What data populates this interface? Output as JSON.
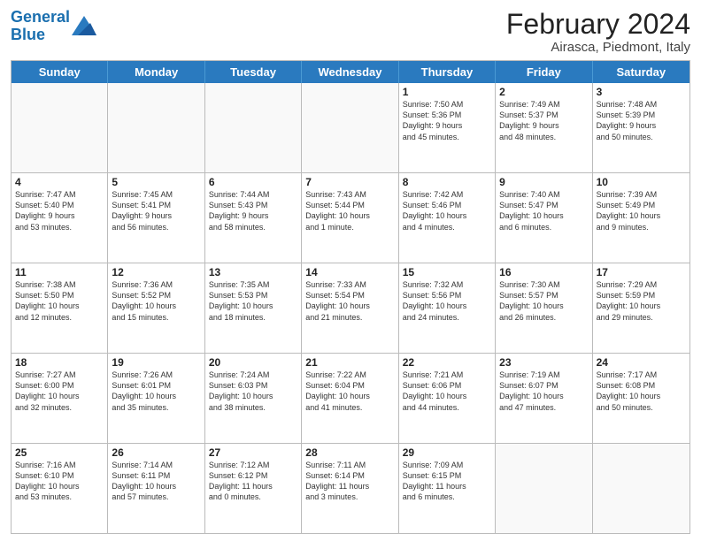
{
  "logo": {
    "line1": "General",
    "line2": "Blue"
  },
  "title": "February 2024",
  "subtitle": "Airasca, Piedmont, Italy",
  "headers": [
    "Sunday",
    "Monday",
    "Tuesday",
    "Wednesday",
    "Thursday",
    "Friday",
    "Saturday"
  ],
  "rows": [
    [
      {
        "day": "",
        "info": ""
      },
      {
        "day": "",
        "info": ""
      },
      {
        "day": "",
        "info": ""
      },
      {
        "day": "",
        "info": ""
      },
      {
        "day": "1",
        "info": "Sunrise: 7:50 AM\nSunset: 5:36 PM\nDaylight: 9 hours\nand 45 minutes."
      },
      {
        "day": "2",
        "info": "Sunrise: 7:49 AM\nSunset: 5:37 PM\nDaylight: 9 hours\nand 48 minutes."
      },
      {
        "day": "3",
        "info": "Sunrise: 7:48 AM\nSunset: 5:39 PM\nDaylight: 9 hours\nand 50 minutes."
      }
    ],
    [
      {
        "day": "4",
        "info": "Sunrise: 7:47 AM\nSunset: 5:40 PM\nDaylight: 9 hours\nand 53 minutes."
      },
      {
        "day": "5",
        "info": "Sunrise: 7:45 AM\nSunset: 5:41 PM\nDaylight: 9 hours\nand 56 minutes."
      },
      {
        "day": "6",
        "info": "Sunrise: 7:44 AM\nSunset: 5:43 PM\nDaylight: 9 hours\nand 58 minutes."
      },
      {
        "day": "7",
        "info": "Sunrise: 7:43 AM\nSunset: 5:44 PM\nDaylight: 10 hours\nand 1 minute."
      },
      {
        "day": "8",
        "info": "Sunrise: 7:42 AM\nSunset: 5:46 PM\nDaylight: 10 hours\nand 4 minutes."
      },
      {
        "day": "9",
        "info": "Sunrise: 7:40 AM\nSunset: 5:47 PM\nDaylight: 10 hours\nand 6 minutes."
      },
      {
        "day": "10",
        "info": "Sunrise: 7:39 AM\nSunset: 5:49 PM\nDaylight: 10 hours\nand 9 minutes."
      }
    ],
    [
      {
        "day": "11",
        "info": "Sunrise: 7:38 AM\nSunset: 5:50 PM\nDaylight: 10 hours\nand 12 minutes."
      },
      {
        "day": "12",
        "info": "Sunrise: 7:36 AM\nSunset: 5:52 PM\nDaylight: 10 hours\nand 15 minutes."
      },
      {
        "day": "13",
        "info": "Sunrise: 7:35 AM\nSunset: 5:53 PM\nDaylight: 10 hours\nand 18 minutes."
      },
      {
        "day": "14",
        "info": "Sunrise: 7:33 AM\nSunset: 5:54 PM\nDaylight: 10 hours\nand 21 minutes."
      },
      {
        "day": "15",
        "info": "Sunrise: 7:32 AM\nSunset: 5:56 PM\nDaylight: 10 hours\nand 24 minutes."
      },
      {
        "day": "16",
        "info": "Sunrise: 7:30 AM\nSunset: 5:57 PM\nDaylight: 10 hours\nand 26 minutes."
      },
      {
        "day": "17",
        "info": "Sunrise: 7:29 AM\nSunset: 5:59 PM\nDaylight: 10 hours\nand 29 minutes."
      }
    ],
    [
      {
        "day": "18",
        "info": "Sunrise: 7:27 AM\nSunset: 6:00 PM\nDaylight: 10 hours\nand 32 minutes."
      },
      {
        "day": "19",
        "info": "Sunrise: 7:26 AM\nSunset: 6:01 PM\nDaylight: 10 hours\nand 35 minutes."
      },
      {
        "day": "20",
        "info": "Sunrise: 7:24 AM\nSunset: 6:03 PM\nDaylight: 10 hours\nand 38 minutes."
      },
      {
        "day": "21",
        "info": "Sunrise: 7:22 AM\nSunset: 6:04 PM\nDaylight: 10 hours\nand 41 minutes."
      },
      {
        "day": "22",
        "info": "Sunrise: 7:21 AM\nSunset: 6:06 PM\nDaylight: 10 hours\nand 44 minutes."
      },
      {
        "day": "23",
        "info": "Sunrise: 7:19 AM\nSunset: 6:07 PM\nDaylight: 10 hours\nand 47 minutes."
      },
      {
        "day": "24",
        "info": "Sunrise: 7:17 AM\nSunset: 6:08 PM\nDaylight: 10 hours\nand 50 minutes."
      }
    ],
    [
      {
        "day": "25",
        "info": "Sunrise: 7:16 AM\nSunset: 6:10 PM\nDaylight: 10 hours\nand 53 minutes."
      },
      {
        "day": "26",
        "info": "Sunrise: 7:14 AM\nSunset: 6:11 PM\nDaylight: 10 hours\nand 57 minutes."
      },
      {
        "day": "27",
        "info": "Sunrise: 7:12 AM\nSunset: 6:12 PM\nDaylight: 11 hours\nand 0 minutes."
      },
      {
        "day": "28",
        "info": "Sunrise: 7:11 AM\nSunset: 6:14 PM\nDaylight: 11 hours\nand 3 minutes."
      },
      {
        "day": "29",
        "info": "Sunrise: 7:09 AM\nSunset: 6:15 PM\nDaylight: 11 hours\nand 6 minutes."
      },
      {
        "day": "",
        "info": ""
      },
      {
        "day": "",
        "info": ""
      }
    ]
  ]
}
